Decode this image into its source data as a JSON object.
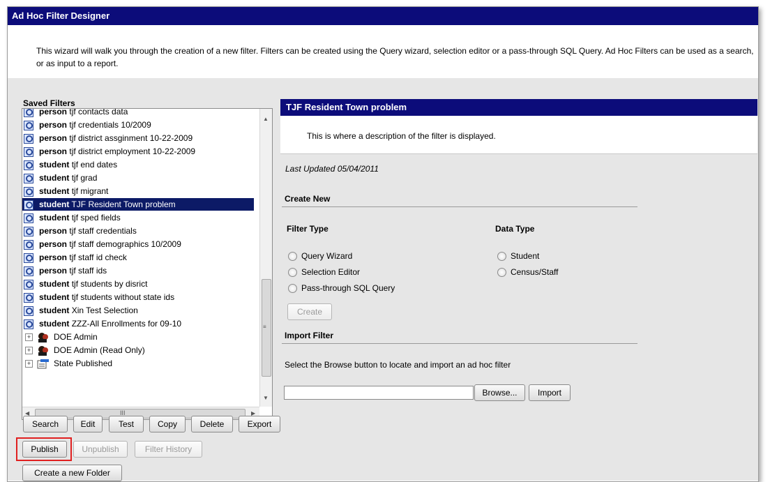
{
  "window": {
    "title": "Ad Hoc Filter Designer",
    "intro": "This wizard will walk you through the creation of a new filter. Filters can be created using the Query wizard, selection editor or a pass-through SQL Query. Ad Hoc Filters can be used as a search, or as input to a report."
  },
  "saved_filters": {
    "label": "Saved Filters",
    "items": [
      {
        "type": "person",
        "name": "tjf contacts data"
      },
      {
        "type": "person",
        "name": "tjf credentials 10/2009"
      },
      {
        "type": "person",
        "name": "tjf district assginment 10-22-2009"
      },
      {
        "type": "person",
        "name": "tjf district employment 10-22-2009"
      },
      {
        "type": "student",
        "name": "tjf end dates"
      },
      {
        "type": "student",
        "name": "tjf grad"
      },
      {
        "type": "student",
        "name": "tjf migrant"
      },
      {
        "type": "student",
        "name": "TJF Resident Town problem"
      },
      {
        "type": "student",
        "name": "tjf sped fields"
      },
      {
        "type": "person",
        "name": "tjf staff credentials"
      },
      {
        "type": "person",
        "name": "tjf staff demographics 10/2009"
      },
      {
        "type": "person",
        "name": "tjf staff id check"
      },
      {
        "type": "person",
        "name": "tjf staff ids"
      },
      {
        "type": "student",
        "name": "tjf students by disrict"
      },
      {
        "type": "student",
        "name": "tjf students without state ids"
      },
      {
        "type": "student",
        "name": "Xin Test Selection"
      },
      {
        "type": "student",
        "name": "ZZZ-All Enrollments for 09-10"
      }
    ],
    "folders": [
      "DOE Admin",
      "DOE Admin (Read Only)",
      "State Published"
    ],
    "selected": "TJF Resident Town problem",
    "scroll_glyph": "III"
  },
  "buttons": {
    "search": "Search",
    "edit": "Edit",
    "test": "Test",
    "copy": "Copy",
    "delete": "Delete",
    "export": "Export",
    "publish": "Publish",
    "unpublish": "Unpublish",
    "filter_history": "Filter History",
    "create_folder": "Create a new Folder"
  },
  "detail": {
    "title": "TJF Resident Town problem",
    "description": "This is where a description of the filter is displayed.",
    "last_updated": "Last Updated 05/04/2011"
  },
  "create_new": {
    "title": "Create New",
    "filter_type_label": "Filter Type",
    "data_type_label": "Data Type",
    "filter_types": [
      "Query Wizard",
      "Selection Editor",
      "Pass-through SQL Query"
    ],
    "data_types": [
      "Student",
      "Census/Staff"
    ],
    "create_button": "Create"
  },
  "import": {
    "title": "Import Filter",
    "instructions": "Select the Browse button to locate and import an ad hoc filter",
    "browse_button": "Browse...",
    "import_button": "Import"
  },
  "colors": {
    "header_bg": "#0c0c7a",
    "selected_bg": "#0c1a66",
    "highlight": "#e02020"
  }
}
